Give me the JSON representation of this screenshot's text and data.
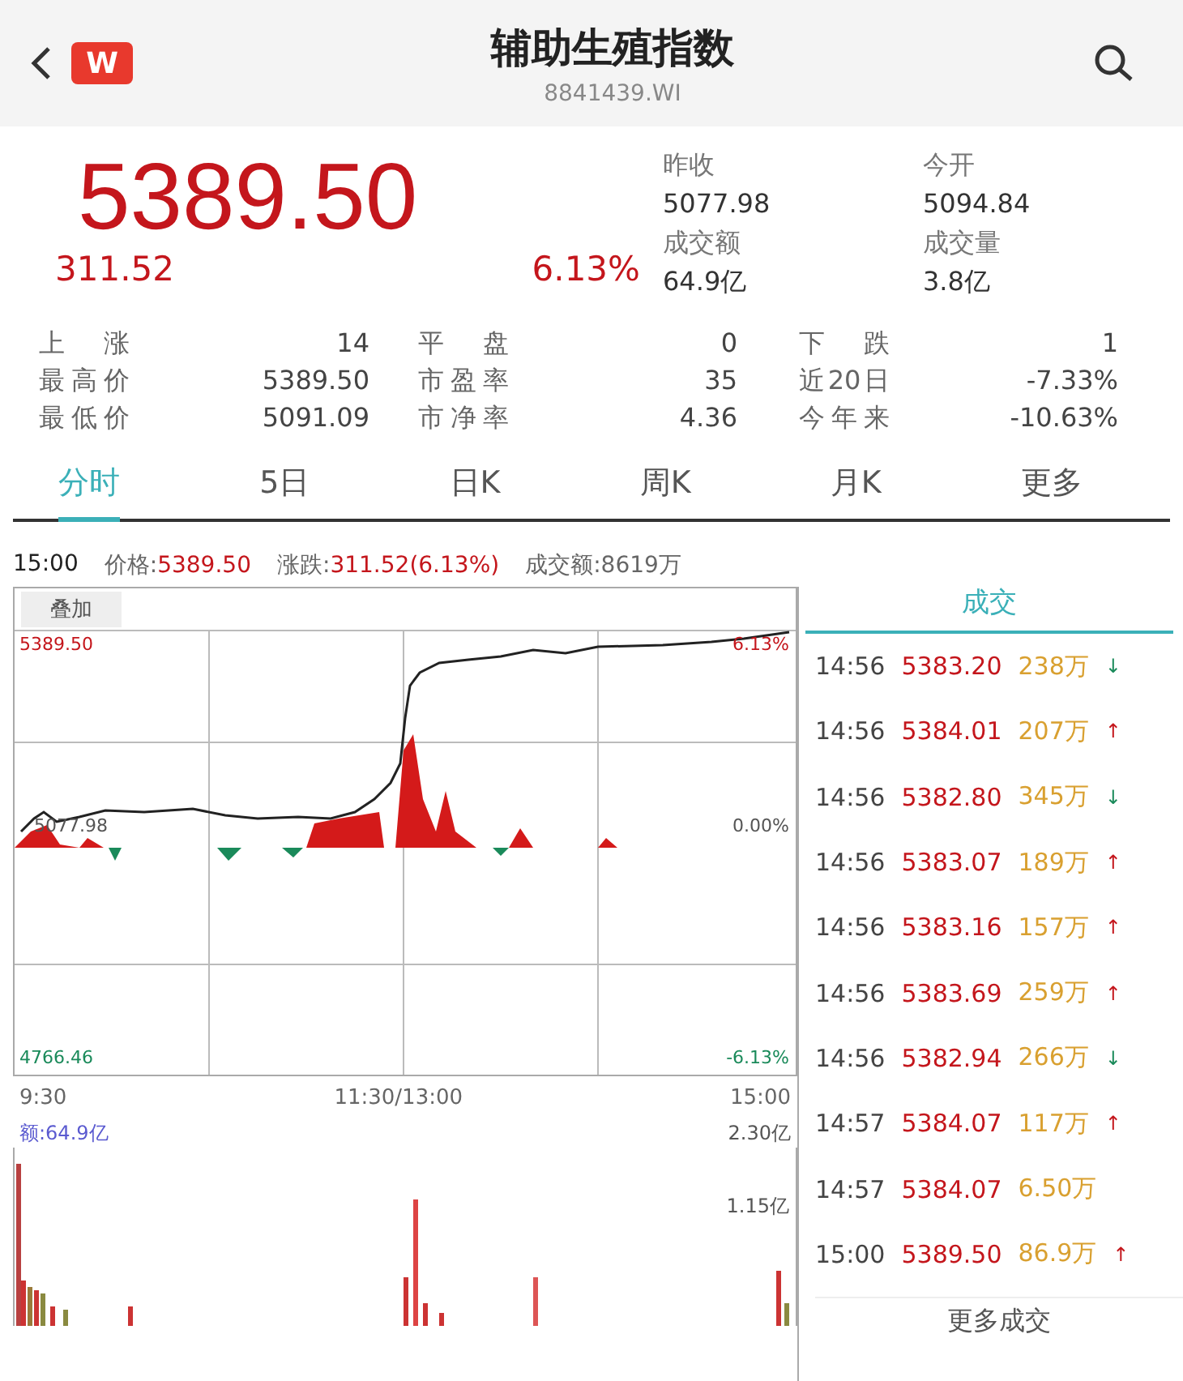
{
  "header": {
    "logo_text": "W",
    "title": "辅助生殖指数",
    "code": "8841439.WI"
  },
  "quote": {
    "price": "5389.50",
    "change": "311.52",
    "change_pct": "6.13%",
    "stats": [
      {
        "label": "昨收",
        "value": "5077.98"
      },
      {
        "label": "今开",
        "value": "5094.84"
      },
      {
        "label": "成交额",
        "value": "64.9亿"
      },
      {
        "label": "成交量",
        "value": "3.8亿"
      }
    ],
    "breadth": [
      [
        {
          "label": "上涨",
          "value": "14"
        },
        {
          "label": "平盘",
          "value": "0"
        },
        {
          "label": "下跌",
          "value": "1"
        }
      ],
      [
        {
          "label": "最高价",
          "value": "5389.50"
        },
        {
          "label": "市盈率",
          "value": "35"
        },
        {
          "label": "近20日",
          "value": "-7.33%"
        }
      ],
      [
        {
          "label": "最低价",
          "value": "5091.09"
        },
        {
          "label": "市净率",
          "value": "4.36"
        },
        {
          "label": "今年来",
          "value": "-10.63%"
        }
      ]
    ]
  },
  "tabs": [
    {
      "label": "分时",
      "selected": true
    },
    {
      "label": "5日",
      "selected": false
    },
    {
      "label": "日K",
      "selected": false
    },
    {
      "label": "周K",
      "selected": false
    },
    {
      "label": "月K",
      "selected": false
    },
    {
      "label": "更多",
      "selected": false
    }
  ],
  "chart": {
    "time": "15:00",
    "price_label": "价格:",
    "price": "5389.50",
    "change_label": "涨跌:",
    "change": "311.52(6.13%)",
    "amount": "成交额:8619万",
    "overlay_button": "叠加",
    "top_price": "5389.50",
    "top_pct": "6.13%",
    "mid_price": "5077.98",
    "mid_pct": "0.00%",
    "bottom_price": "4766.46",
    "bottom_pct": "-6.13%",
    "times": [
      "9:30",
      "11:30/13:00",
      "15:00"
    ],
    "volume_label": "额:64.9亿",
    "volume_max": "2.30亿",
    "volume_mid": "1.15亿"
  },
  "trades": {
    "title": "成交",
    "more": "更多成交",
    "rows": [
      {
        "time": "14:56",
        "price": "5383.20",
        "volume": "238万",
        "arrow": "↓",
        "color": "#1a8a5a"
      },
      {
        "time": "14:56",
        "price": "5384.01",
        "volume": "207万",
        "arrow": "↑",
        "color": "#c4161c"
      },
      {
        "time": "14:56",
        "price": "5382.80",
        "volume": "345万",
        "arrow": "↓",
        "color": "#1a8a5a"
      },
      {
        "time": "14:56",
        "price": "5383.07",
        "volume": "189万",
        "arrow": "↑",
        "color": "#c4161c"
      },
      {
        "time": "14:56",
        "price": "5383.16",
        "volume": "157万",
        "arrow": "↑",
        "color": "#c4161c"
      },
      {
        "time": "14:56",
        "price": "5383.69",
        "volume": "259万",
        "arrow": "↑",
        "color": "#c4161c"
      },
      {
        "time": "14:56",
        "price": "5382.94",
        "volume": "266万",
        "arrow": "↓",
        "color": "#1a8a5a"
      },
      {
        "time": "14:57",
        "price": "5384.07",
        "volume": "117万",
        "arrow": "↑",
        "color": "#c4161c"
      },
      {
        "time": "14:57",
        "price": "5384.07",
        "volume": "6.50万"
      },
      {
        "time": "15:00",
        "price": "5389.50",
        "volume": "86.9万",
        "arrow": "↑",
        "color": "#c4161c"
      }
    ]
  }
}
